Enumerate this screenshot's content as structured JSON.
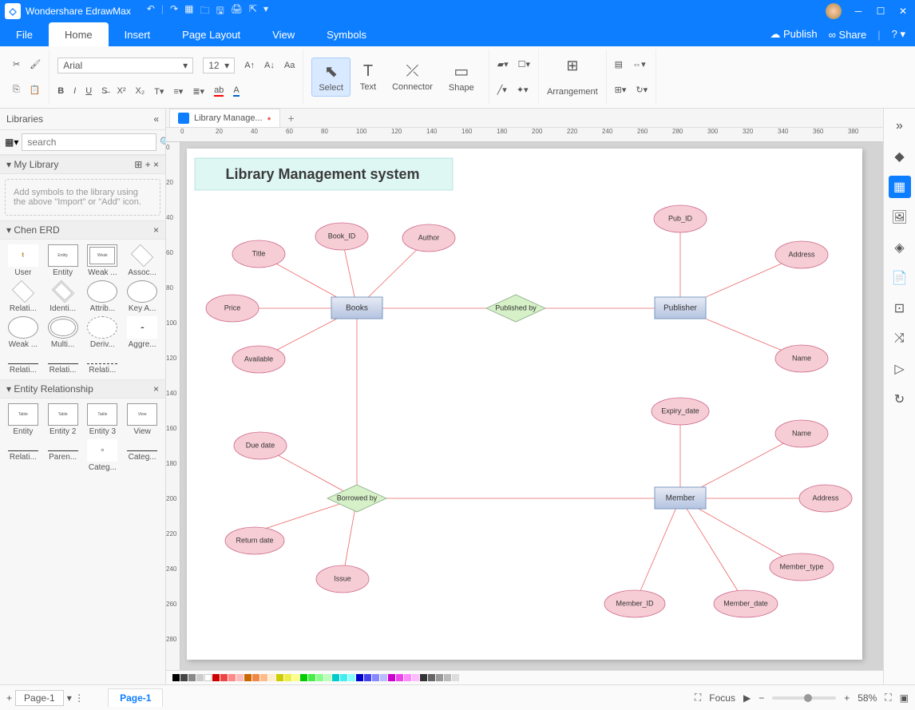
{
  "app": {
    "name": "Wondershare EdrawMax"
  },
  "menu": {
    "tabs": [
      "File",
      "Home",
      "Insert",
      "Page Layout",
      "View",
      "Symbols"
    ],
    "active": "Home",
    "publish": "Publish",
    "share": "Share"
  },
  "ribbon": {
    "font": "Arial",
    "size": "12",
    "tools": {
      "select": "Select",
      "text": "Text",
      "connector": "Connector",
      "shape": "Shape",
      "arrangement": "Arrangement"
    }
  },
  "libraries": {
    "title": "Libraries",
    "searchPlaceholder": "search",
    "myLibrary": {
      "title": "My Library",
      "hint": "Add symbols to the library using the above \"Import\" or \"Add\" icon."
    },
    "chenERD": {
      "title": "Chen ERD",
      "items": [
        "User",
        "Entity",
        "Weak ...",
        "Assoc...",
        "Relati...",
        "Identi...",
        "Attrib...",
        "Key A...",
        "Weak ...",
        "Multi...",
        "Deriv...",
        "Aggre...",
        "Relati...",
        "Relati...",
        "Relati..."
      ]
    },
    "entityRel": {
      "title": "Entity Relationship",
      "items": [
        "Entity",
        "Entity 2",
        "Entity 3",
        "View",
        "Relati...",
        "Paren...",
        "Categ...",
        "Categ..."
      ]
    }
  },
  "docTab": {
    "name": "Library Manage..."
  },
  "diagram": {
    "title": "Library Management system",
    "entities": {
      "books": {
        "label": "Books",
        "attrs": [
          "Title",
          "Book_ID",
          "Author",
          "Price",
          "Available"
        ]
      },
      "publisher": {
        "label": "Publisher",
        "attrs": [
          "Pub_ID",
          "Address",
          "Name"
        ]
      },
      "member": {
        "label": "Member",
        "attrs": [
          "Expiry_date",
          "Name",
          "Address",
          "Member_type",
          "Member_date",
          "Member_ID"
        ]
      }
    },
    "relationships": {
      "publishedBy": {
        "label": "Published by"
      },
      "borrowedBy": {
        "label": "Borrowed by",
        "attrs": [
          "Due date",
          "Return date",
          "Issue"
        ]
      }
    }
  },
  "status": {
    "page": "Page-1",
    "tab": "Page-1",
    "focus": "Focus",
    "zoom": "58%"
  },
  "ruler": {
    "h": [
      "0",
      "20",
      "40",
      "60",
      "80",
      "100",
      "120",
      "140",
      "160",
      "180",
      "200",
      "220",
      "240",
      "260",
      "280",
      "300",
      "320",
      "340",
      "360",
      "380"
    ],
    "v": [
      "0",
      "20",
      "40",
      "60",
      "80",
      "100",
      "120",
      "140",
      "160",
      "180",
      "200",
      "220",
      "240",
      "260",
      "280"
    ]
  }
}
